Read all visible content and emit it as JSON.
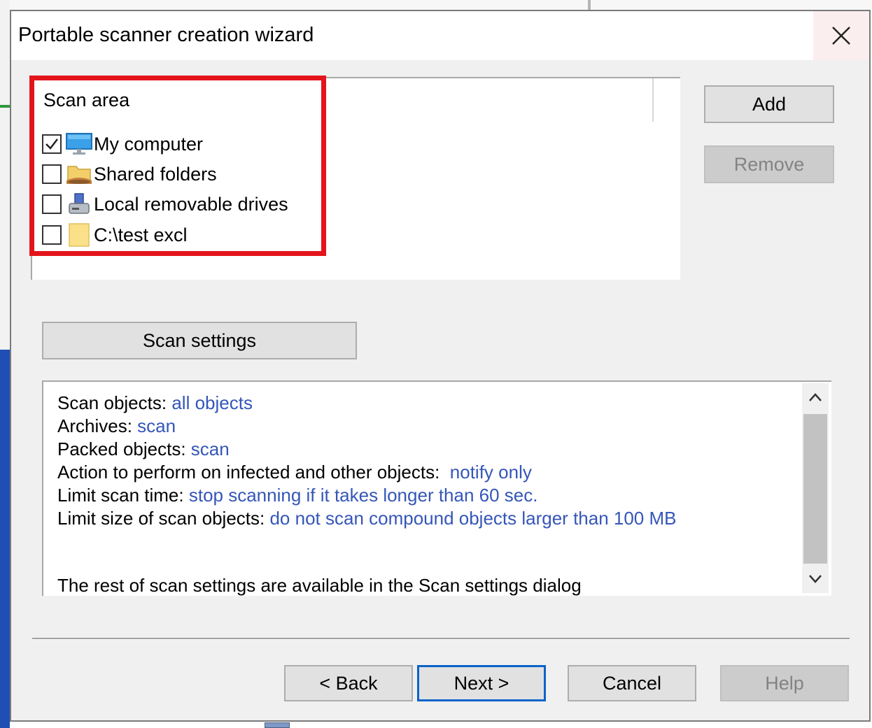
{
  "window": {
    "title": "Portable scanner creation wizard"
  },
  "scan_area": {
    "header": "Scan area",
    "items": [
      {
        "label": "My computer",
        "checked": true,
        "icon": "monitor-icon"
      },
      {
        "label": "Shared folders",
        "checked": false,
        "icon": "shared-folder-icon"
      },
      {
        "label": "Local removable drives",
        "checked": false,
        "icon": "removable-drive-icon"
      },
      {
        "label": "C:\\test excl",
        "checked": false,
        "icon": "folder-icon"
      }
    ]
  },
  "side_buttons": {
    "add": "Add",
    "remove": "Remove"
  },
  "scan_settings_button": "Scan settings",
  "summary": {
    "lines": [
      {
        "key": "Scan objects:",
        "value": "all objects"
      },
      {
        "key": "Archives:",
        "value": "scan"
      },
      {
        "key": "Packed objects:",
        "value": "scan"
      },
      {
        "key": "Action to perform on infected and other objects:",
        "value": "notify only"
      },
      {
        "key": "Limit scan time:",
        "value": "stop scanning if it takes longer than 60 sec."
      },
      {
        "key": "Limit size of scan objects:",
        "value": "do not scan compound objects larger than 100 MB"
      }
    ],
    "footer": "The rest of scan settings are available in the Scan settings dialog"
  },
  "footer_buttons": {
    "back": "< Back",
    "next": "Next >",
    "cancel": "Cancel",
    "help": "Help"
  },
  "colors": {
    "highlight": "#e3141c",
    "link_value": "#3556b8",
    "default_button_border": "#0b63c9"
  }
}
